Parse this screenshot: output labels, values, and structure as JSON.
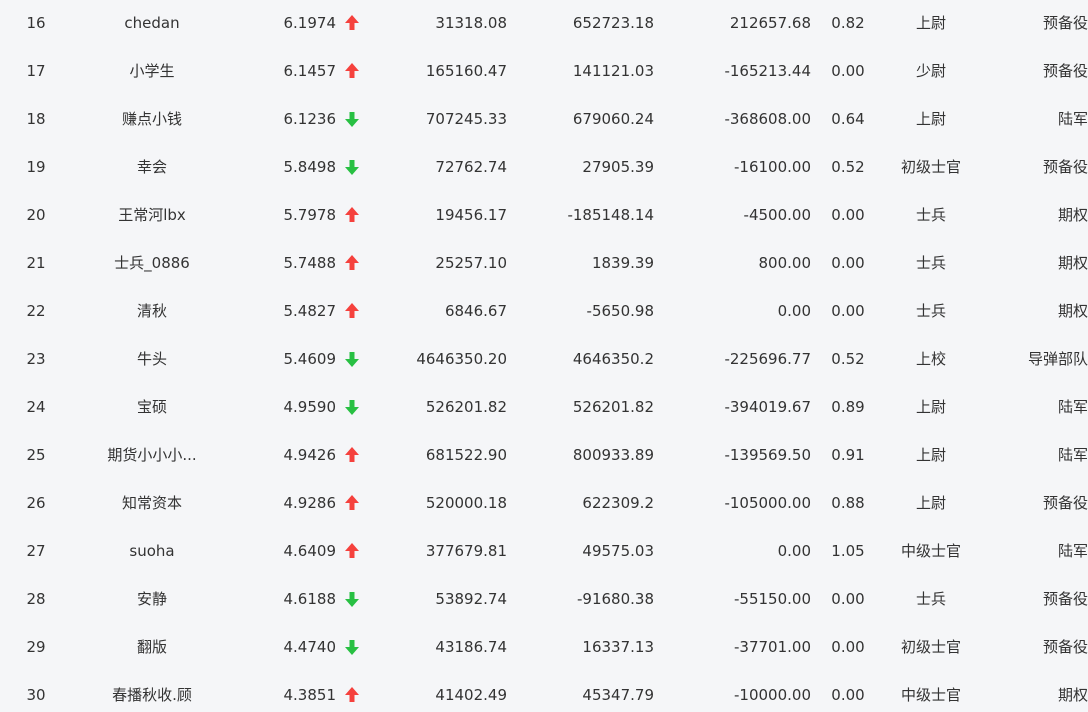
{
  "colors": {
    "up": "#f5413d",
    "down": "#28c043",
    "text": "#333333",
    "background": "#f5f6f8"
  },
  "rows": [
    {
      "rank": "16",
      "name": "chedan",
      "score": "6.1974",
      "trend": "up",
      "a": "31318.08",
      "b": "652723.18",
      "c": "212657.68",
      "ratio": "0.82",
      "title": "上尉",
      "group": "预备役"
    },
    {
      "rank": "17",
      "name": "小学生",
      "score": "6.1457",
      "trend": "up",
      "a": "165160.47",
      "b": "141121.03",
      "c": "-165213.44",
      "ratio": "0.00",
      "title": "少尉",
      "group": "预备役"
    },
    {
      "rank": "18",
      "name": "赚点小钱",
      "score": "6.1236",
      "trend": "down",
      "a": "707245.33",
      "b": "679060.24",
      "c": "-368608.00",
      "ratio": "0.64",
      "title": "上尉",
      "group": "陆军"
    },
    {
      "rank": "19",
      "name": "幸会",
      "score": "5.8498",
      "trend": "down",
      "a": "72762.74",
      "b": "27905.39",
      "c": "-16100.00",
      "ratio": "0.52",
      "title": "初级士官",
      "group": "预备役"
    },
    {
      "rank": "20",
      "name": "王常河lbx",
      "score": "5.7978",
      "trend": "up",
      "a": "19456.17",
      "b": "-185148.14",
      "c": "-4500.00",
      "ratio": "0.00",
      "title": "士兵",
      "group": "期权"
    },
    {
      "rank": "21",
      "name": "士兵_0886",
      "score": "5.7488",
      "trend": "up",
      "a": "25257.10",
      "b": "1839.39",
      "c": "800.00",
      "ratio": "0.00",
      "title": "士兵",
      "group": "期权"
    },
    {
      "rank": "22",
      "name": "清秋",
      "score": "5.4827",
      "trend": "up",
      "a": "6846.67",
      "b": "-5650.98",
      "c": "0.00",
      "ratio": "0.00",
      "title": "士兵",
      "group": "期权"
    },
    {
      "rank": "23",
      "name": "牛头",
      "score": "5.4609",
      "trend": "down",
      "a": "4646350.20",
      "b": "4646350.2",
      "c": "-225696.77",
      "ratio": "0.52",
      "title": "上校",
      "group": "导弹部队"
    },
    {
      "rank": "24",
      "name": "宝硕",
      "score": "4.9590",
      "trend": "down",
      "a": "526201.82",
      "b": "526201.82",
      "c": "-394019.67",
      "ratio": "0.89",
      "title": "上尉",
      "group": "陆军"
    },
    {
      "rank": "25",
      "name": "期货小小小...",
      "score": "4.9426",
      "trend": "up",
      "a": "681522.90",
      "b": "800933.89",
      "c": "-139569.50",
      "ratio": "0.91",
      "title": "上尉",
      "group": "陆军"
    },
    {
      "rank": "26",
      "name": "知常资本",
      "score": "4.9286",
      "trend": "up",
      "a": "520000.18",
      "b": "622309.2",
      "c": "-105000.00",
      "ratio": "0.88",
      "title": "上尉",
      "group": "预备役"
    },
    {
      "rank": "27",
      "name": "suoha",
      "score": "4.6409",
      "trend": "up",
      "a": "377679.81",
      "b": "49575.03",
      "c": "0.00",
      "ratio": "1.05",
      "title": "中级士官",
      "group": "陆军"
    },
    {
      "rank": "28",
      "name": "安静",
      "score": "4.6188",
      "trend": "down",
      "a": "53892.74",
      "b": "-91680.38",
      "c": "-55150.00",
      "ratio": "0.00",
      "title": "士兵",
      "group": "预备役"
    },
    {
      "rank": "29",
      "name": "翻版",
      "score": "4.4740",
      "trend": "down",
      "a": "43186.74",
      "b": "16337.13",
      "c": "-37701.00",
      "ratio": "0.00",
      "title": "初级士官",
      "group": "预备役"
    },
    {
      "rank": "30",
      "name": "春播秋收.顾",
      "score": "4.3851",
      "trend": "up",
      "a": "41402.49",
      "b": "45347.79",
      "c": "-10000.00",
      "ratio": "0.00",
      "title": "中级士官",
      "group": "期权"
    }
  ]
}
